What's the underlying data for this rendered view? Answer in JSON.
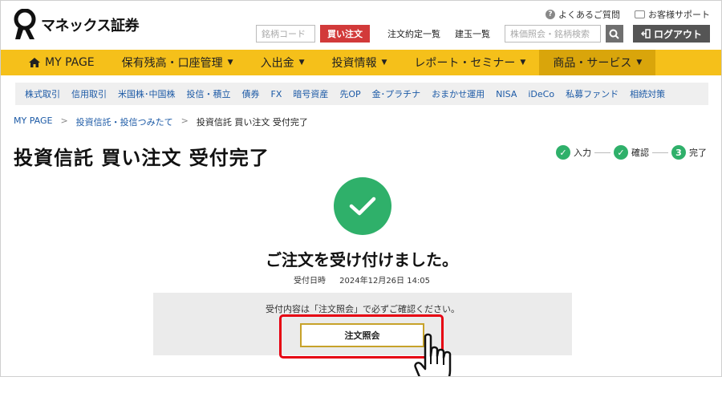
{
  "brand": {
    "name": "マネックス証券"
  },
  "top_links": {
    "faq": "よくあるご質問",
    "support": "お客様サポート"
  },
  "header": {
    "ticker_placeholder": "銘柄コード",
    "buy_order": "買い注文",
    "order_list": "注文約定一覧",
    "position_list": "建玉一覧",
    "search_placeholder": "株価照会・銘柄検索",
    "logout": "ログアウト"
  },
  "main_nav": [
    {
      "label": "MY PAGE"
    },
    {
      "label": "保有残高・口座管理"
    },
    {
      "label": "入出金"
    },
    {
      "label": "投資情報"
    },
    {
      "label": "レポート・セミナー"
    },
    {
      "label": "商品・サービス"
    }
  ],
  "sub_nav": [
    "株式取引",
    "信用取引",
    "米国株･中国株",
    "投信・積立",
    "債券",
    "FX",
    "暗号資産",
    "先OP",
    "金･プラチナ",
    "おまかせ運用",
    "NISA",
    "iDeCo",
    "私募ファンド",
    "相続対策"
  ],
  "breadcrumb": {
    "home": "MY PAGE",
    "parent": "投資信託・投信つみたて",
    "current": "投資信託 買い注文 受付完了",
    "sep": ">"
  },
  "page_title": "投資信託 買い注文 受付完了",
  "steps": [
    {
      "label": "入力",
      "num": "✓"
    },
    {
      "label": "確認",
      "num": "✓"
    },
    {
      "label": "完了",
      "num": "3"
    }
  ],
  "result": {
    "message": "ご注文を受け付けました。",
    "date_label": "受付日時",
    "date_value": "2024年12月26日 14:05",
    "info": "受付内容は「注文照会」で必ずご確認ください。",
    "button": "注文照会"
  },
  "colors": {
    "accent": "#f5c01a",
    "success": "#2fb06a",
    "highlight": "#e60012"
  }
}
